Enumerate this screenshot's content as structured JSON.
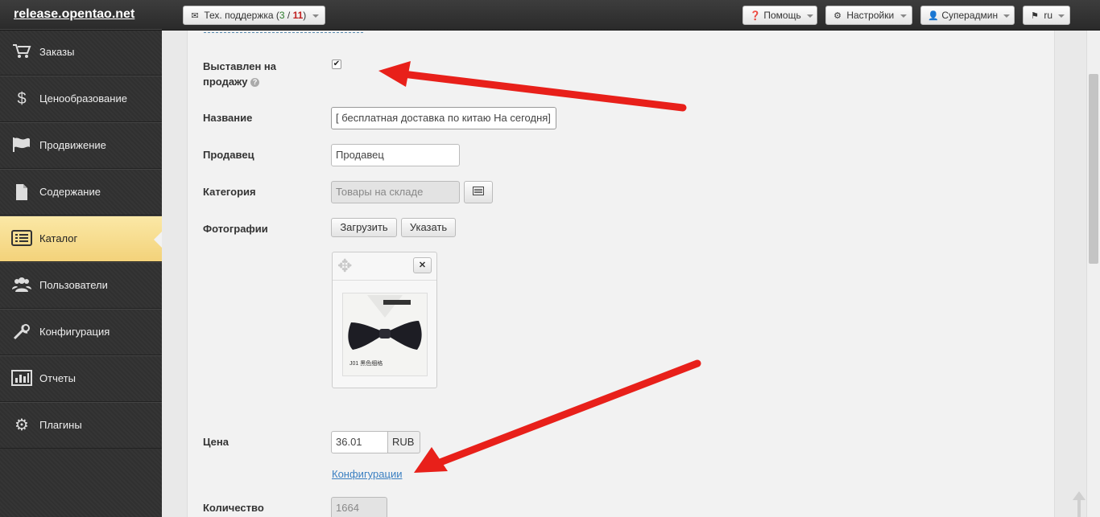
{
  "header": {
    "brand": "release.opentao.net",
    "support": {
      "label": "Тех. поддержка",
      "open": "3",
      "sep": " / ",
      "total": "11"
    },
    "help": "Помощь",
    "settings": "Настройки",
    "user": "Суперадмин",
    "lang": "ru"
  },
  "sidebar": {
    "items": [
      {
        "label": "Заказы",
        "icon": "cart-icon"
      },
      {
        "label": "Ценообразование",
        "icon": "dollar-icon"
      },
      {
        "label": "Продвижение",
        "icon": "flag-icon"
      },
      {
        "label": "Содержание",
        "icon": "file-icon"
      },
      {
        "label": "Каталог",
        "icon": "list-icon",
        "active": true
      },
      {
        "label": "Пользователи",
        "icon": "users-icon"
      },
      {
        "label": "Конфигурация",
        "icon": "wrench-icon"
      },
      {
        "label": "Отчеты",
        "icon": "chart-icon"
      },
      {
        "label": "Плагины",
        "icon": "gear-icon"
      }
    ]
  },
  "form": {
    "on_sale_label_1": "Выставлен на",
    "on_sale_label_2": "продажу",
    "on_sale_checked": true,
    "name_label": "Название",
    "name_value": "[ бесплатная доставка по китаю На сегодня]",
    "seller_label": "Продавец",
    "seller_placeholder": "Продавец",
    "category_label": "Категория",
    "category_value": "Товары на складе",
    "photos_label": "Фотографии",
    "upload_button": "Загрузить",
    "specify_button": "Указать",
    "photo_caption": "J01 黑色细格",
    "price_label": "Цена",
    "price_value": "36.01",
    "currency": "RUB",
    "configurations_link": "Конфигурации",
    "quantity_label": "Количество",
    "quantity_value": "1664"
  },
  "colors": {
    "accent_active": "#f3d27a",
    "link": "#3a7fc1",
    "arrow": "#e8201a",
    "badge_red": "#c02020"
  }
}
